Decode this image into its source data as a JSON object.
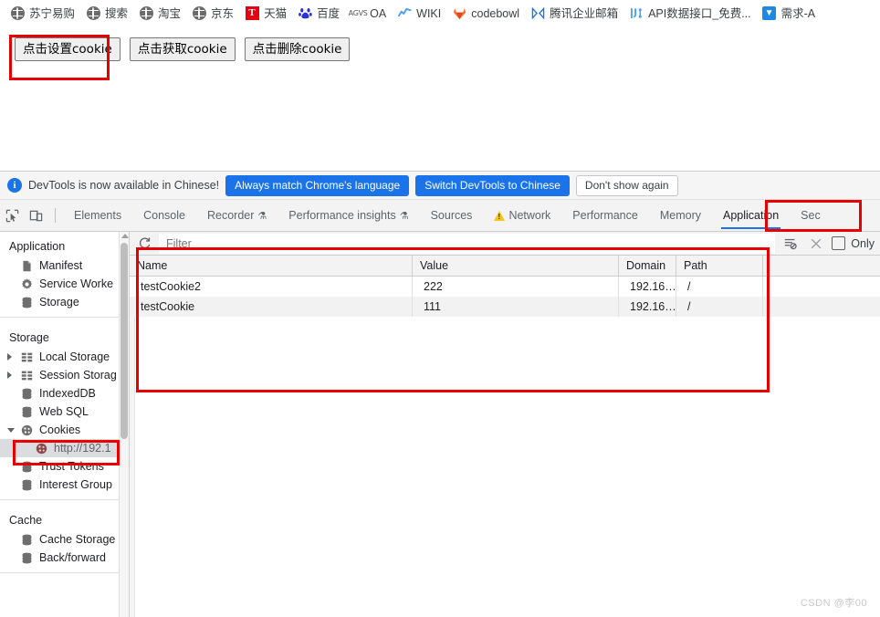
{
  "bookmarks": [
    {
      "label": "苏宁易购",
      "icon": "globe-icon"
    },
    {
      "label": "搜索",
      "icon": "globe-icon"
    },
    {
      "label": "淘宝",
      "icon": "globe-icon"
    },
    {
      "label": "京东",
      "icon": "globe-icon"
    },
    {
      "label": "天猫",
      "icon": "tmall-icon"
    },
    {
      "label": "百度",
      "icon": "baidu-paw-icon"
    },
    {
      "label": "OA",
      "icon": "agvs-icon"
    },
    {
      "label": "WIKI",
      "icon": "wiki-chart-icon"
    },
    {
      "label": "codebowl",
      "icon": "gitlab-fox-icon"
    },
    {
      "label": "腾讯企业邮箱",
      "icon": "tencent-mail-icon"
    },
    {
      "label": "API数据接口_免费...",
      "icon": "api-icon"
    },
    {
      "label": "需求-A",
      "icon": "demand-icon"
    }
  ],
  "page": {
    "buttons": [
      {
        "label": "点击设置cookie",
        "name": "set-cookie-button"
      },
      {
        "label": "点击获取cookie",
        "name": "get-cookie-button"
      },
      {
        "label": "点击删除cookie",
        "name": "delete-cookie-button"
      }
    ]
  },
  "notification": {
    "icon": "info-icon",
    "message": "DevTools is now available in Chinese!",
    "primary_button": "Always match Chrome's language",
    "secondary_button": "Switch DevTools to Chinese",
    "dismiss_button": "Don't show again"
  },
  "devtools_tabs": {
    "inspect_icon": "inspect-cursor-icon",
    "device_icon": "device-toolbar-icon",
    "items": [
      {
        "label": "Elements",
        "badge": ""
      },
      {
        "label": "Console",
        "badge": ""
      },
      {
        "label": "Recorder",
        "badge": "flask-icon"
      },
      {
        "label": "Performance insights",
        "badge": "flask-icon"
      },
      {
        "label": "Sources",
        "badge": ""
      },
      {
        "label": "Network",
        "badge": "warning-icon"
      },
      {
        "label": "Performance",
        "badge": ""
      },
      {
        "label": "Memory",
        "badge": ""
      },
      {
        "label": "Application",
        "badge": "",
        "active": true
      },
      {
        "label": "Sec",
        "badge": ""
      }
    ]
  },
  "sidebar": {
    "sections": [
      {
        "title": "Application",
        "items": [
          {
            "label": "Manifest",
            "icon": "document-icon",
            "expandable": false
          },
          {
            "label": "Service Worke",
            "icon": "gear-icon",
            "expandable": false
          },
          {
            "label": "Storage",
            "icon": "database-icon",
            "expandable": false
          }
        ]
      },
      {
        "title": "Storage",
        "items": [
          {
            "label": "Local Storage",
            "icon": "grid-icon",
            "expandable": true
          },
          {
            "label": "Session Storag",
            "icon": "grid-icon",
            "expandable": true
          },
          {
            "label": "IndexedDB",
            "icon": "database-icon",
            "expandable": false
          },
          {
            "label": "Web SQL",
            "icon": "database-icon",
            "expandable": false
          },
          {
            "label": "Cookies",
            "icon": "cookie-icon",
            "expandable": true,
            "expanded": true
          },
          {
            "label": "http://192.1",
            "icon": "cookie-icon",
            "child": true,
            "selected": true
          },
          {
            "label": "Trust Tokens",
            "icon": "database-icon",
            "expandable": false
          },
          {
            "label": "Interest Group",
            "icon": "database-icon",
            "expandable": false
          }
        ]
      },
      {
        "title": "Cache",
        "items": [
          {
            "label": "Cache Storage",
            "icon": "database-icon",
            "expandable": false
          },
          {
            "label": "Back/forward",
            "icon": "database-icon",
            "expandable": false
          }
        ]
      }
    ]
  },
  "filterbar": {
    "refresh_icon": "refresh-icon",
    "filter_placeholder": "Filter",
    "filter_value": "",
    "clear_filtered_icon": "clear-filtered-cookies-icon",
    "clear_all_icon": "clear-all-cookies-icon",
    "only_checkbox_label": "Only",
    "only_checked": false
  },
  "cookie_table": {
    "columns": [
      "Name",
      "Value",
      "Domain",
      "Path"
    ],
    "rows": [
      {
        "Name": "testCookie2",
        "Value": "222",
        "Domain": "192.16…",
        "Path": "/"
      },
      {
        "Name": "testCookie",
        "Value": "111",
        "Domain": "192.16…",
        "Path": "/"
      }
    ]
  },
  "annotations": {
    "set_cookie_box": "red-highlight-box",
    "application_tab_box": "red-highlight-box",
    "cookie_table_box": "red-highlight-box",
    "cookies_item_box": "red-highlight-box"
  },
  "watermark": "CSDN @李00",
  "colors": {
    "accent_blue": "#1a73e8",
    "annotation_red": "#e60000",
    "tab_active_underline": "#1a73e8"
  }
}
